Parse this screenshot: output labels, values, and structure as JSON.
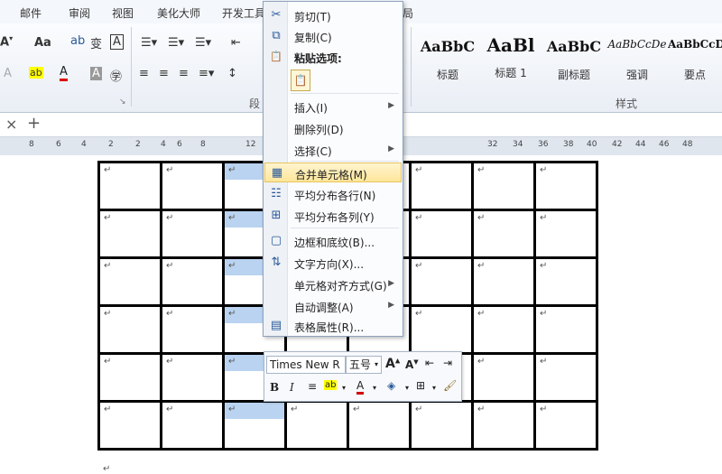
{
  "tabs": [
    "邮件",
    "审阅",
    "视图",
    "美化大师",
    "开发工具",
    "局"
  ],
  "ribbon": {
    "font_size_buttons": [
      "A",
      "A"
    ],
    "aa_label": "Aa",
    "paragraph_label": "段",
    "styles_group_label": "样式",
    "styles": [
      {
        "preview": "AaBbC",
        "caption": "标题"
      },
      {
        "preview": "AaBl",
        "caption": "标题 1"
      },
      {
        "preview": "AaBbC",
        "caption": "副标题"
      },
      {
        "preview": "AaBbCcDe",
        "caption": "强调"
      },
      {
        "preview": "AaBbCcDd",
        "caption": "要点"
      }
    ]
  },
  "toolrow": {
    "close": "×",
    "add": "+"
  },
  "ruler": {
    "numbers": [
      "8",
      "6",
      "4",
      "2",
      "2",
      "4",
      "6",
      "8",
      "12",
      "32",
      "34",
      "36",
      "38",
      "40",
      "42",
      "44",
      "46",
      "48"
    ]
  },
  "context_menu": {
    "items": [
      {
        "label": "剪切(T)",
        "icon": "scissors-icon",
        "glyph": "✂"
      },
      {
        "label": "复制(C)",
        "icon": "copy-icon",
        "glyph": "⧉"
      },
      {
        "label": "粘贴选项:",
        "icon": "paste-icon",
        "glyph": "📋",
        "bold": true
      },
      {
        "label": "插入(I)",
        "icon": "",
        "glyph": "",
        "submenu": true
      },
      {
        "label": "删除列(D)",
        "icon": "",
        "glyph": ""
      },
      {
        "label": "选择(C)",
        "icon": "",
        "glyph": "",
        "submenu": true
      },
      {
        "label": "合并单元格(M)",
        "icon": "merge-cells-icon",
        "glyph": "▦",
        "highlighted": true
      },
      {
        "label": "平均分布各行(N)",
        "icon": "distribute-rows-icon",
        "glyph": "☷"
      },
      {
        "label": "平均分布各列(Y)",
        "icon": "distribute-columns-icon",
        "glyph": "⊞"
      },
      {
        "label": "边框和底纹(B)...",
        "icon": "borders-icon",
        "glyph": "▢"
      },
      {
        "label": "文字方向(X)...",
        "icon": "text-direction-icon",
        "glyph": "⇅"
      },
      {
        "label": "单元格对齐方式(G)",
        "icon": "",
        "glyph": "",
        "submenu": true
      },
      {
        "label": "自动调整(A)",
        "icon": "",
        "glyph": "",
        "submenu": true
      },
      {
        "label": "表格属性(R)...",
        "icon": "table-properties-icon",
        "glyph": "▤"
      }
    ]
  },
  "mini_toolbar": {
    "font_name": "Times New R",
    "font_size": "五号",
    "bold": "B",
    "italic": "I",
    "font_color_label": "A"
  },
  "table": {
    "rows": 6,
    "cols": 8,
    "cell_mark": "↵"
  },
  "colors": {
    "highlight": "#fde69a",
    "selection": "#b9d3f0",
    "font_red": "#d00000"
  }
}
